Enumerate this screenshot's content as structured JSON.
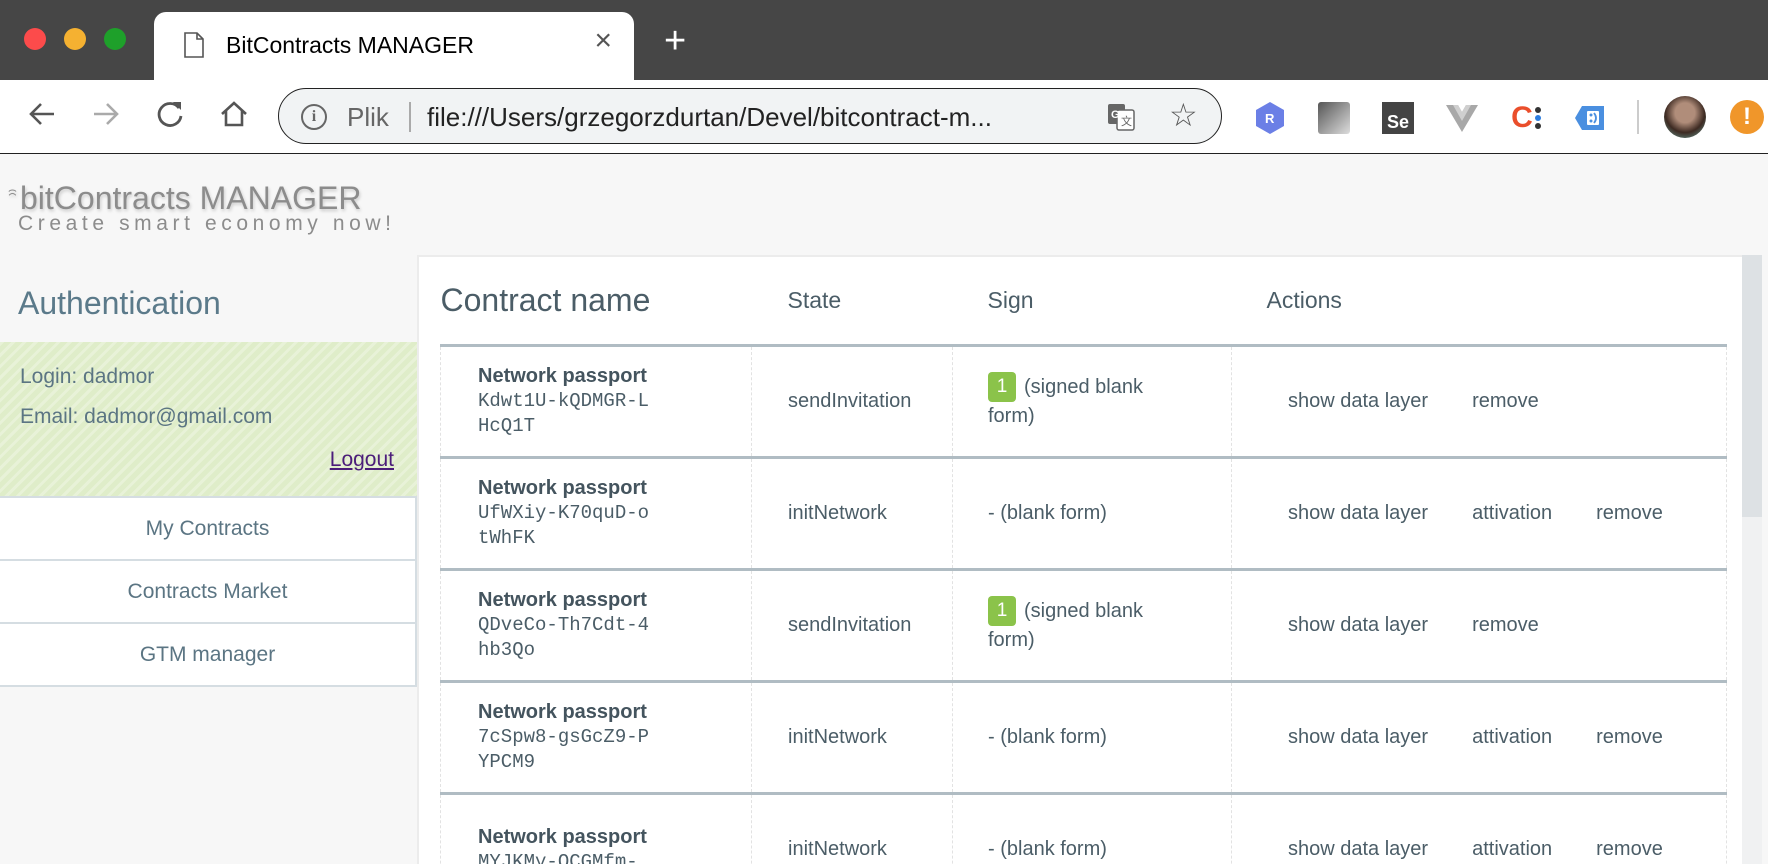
{
  "browser": {
    "tab_title": "BitContracts MANAGER",
    "tab_close": "×",
    "new_tab": "+",
    "omnibox": {
      "scheme_label": "Plik",
      "url": "file:///Users/grzegorzdurtan/Devel/bitcontract-m..."
    },
    "extensions": [
      {
        "icon": "r-hexagon-icon",
        "label": "R",
        "color": "#6b7fe6"
      },
      {
        "icon": "gradient-square-icon",
        "label": "",
        "color": "#888888"
      },
      {
        "icon": "selenium-ide-icon",
        "label": "Se",
        "color": "#444444"
      },
      {
        "icon": "vue-devtools-icon",
        "label": "",
        "color": "#a0a0a0"
      },
      {
        "icon": "c-dots-icon",
        "label": "C",
        "color": "#ea4e2b"
      },
      {
        "icon": "tag-assistant-icon",
        "label": "",
        "color": "#4a8fe0"
      }
    ],
    "alert_label": "!"
  },
  "app": {
    "brand_icon": "ꩰ",
    "brand": "bitContracts MANAGER",
    "tagline": "Create smart economy now!"
  },
  "sidebar": {
    "auth_title": "Authentication",
    "login": "Login: dadmor",
    "email": "Email: dadmor@gmail.com",
    "logout": "Logout",
    "nav": [
      {
        "label": "My Contracts"
      },
      {
        "label": "Contracts Market"
      },
      {
        "label": "GTM manager"
      }
    ]
  },
  "table": {
    "headers": {
      "name": "Contract name",
      "state": "State",
      "sign": "Sign",
      "actions": "Actions"
    },
    "rows": [
      {
        "name": "Network passport",
        "id": "Kdwt1U-kQDMGR-LHcQ1T",
        "state": "sendInvitation",
        "sign_badge": "1",
        "sign_text": "(signed blank form)",
        "actions": [
          "show data layer",
          "remove"
        ]
      },
      {
        "name": "Network passport",
        "id": "UfWXiy-K70quD-otWhFK",
        "state": "initNetwork",
        "sign_badge": "",
        "sign_text": "- (blank form)",
        "actions": [
          "show data layer",
          "attivation",
          "remove"
        ]
      },
      {
        "name": "Network passport",
        "id": "QDveCo-Th7Cdt-4hb3Qo",
        "state": "sendInvitation",
        "sign_badge": "1",
        "sign_text": "(signed blank form)",
        "actions": [
          "show data layer",
          "remove"
        ]
      },
      {
        "name": "Network passport",
        "id": "7cSpw8-gsGcZ9-PYPCM9",
        "state": "initNetwork",
        "sign_badge": "",
        "sign_text": "- (blank form)",
        "actions": [
          "show data layer",
          "attivation",
          "remove"
        ]
      },
      {
        "name": "Network passport",
        "id": "MYJKMy-OCGMfm-",
        "state": "initNetwork",
        "sign_badge": "",
        "sign_text": "- (blank form)",
        "actions": [
          "show data layer",
          "attivation",
          "remove"
        ]
      }
    ]
  },
  "colors": {
    "badge": "#8bc34a",
    "text": "#4b5d67",
    "user_box": "#dfedc9",
    "brand": "#8c8c8c"
  }
}
